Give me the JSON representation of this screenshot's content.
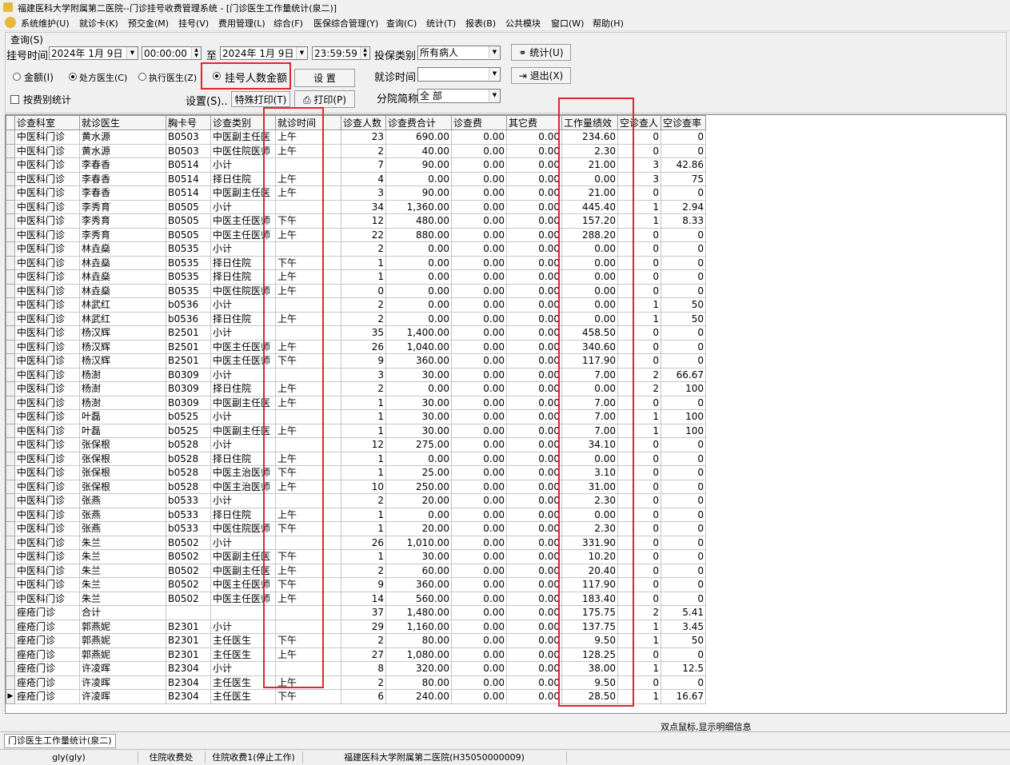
{
  "window": {
    "title": "福建医科大学附属第二医院--门诊挂号收费管理系统 - [门诊医生工作量统计(泉二)]"
  },
  "menu": [
    "系统维护(U)",
    "就诊卡(K)",
    "预交金(M)",
    "挂号(V)",
    "费用管理(L)",
    "综合(F)",
    "医保综合管理(Y)",
    "查询(C)",
    "统计(T)",
    "报表(B)",
    "公共模块",
    "窗口(W)",
    "帮助(H)"
  ],
  "query": {
    "group_label": "查询(S)",
    "reg_time_label": "挂号时间",
    "date_from": "2024年 1月 9日",
    "time_from": "00:00:00",
    "to_label": "至",
    "date_to": "2024年 1月 9日",
    "time_to": "23:59:59",
    "insurance_label": "投保类别",
    "insurance_value": "所有病人",
    "stat_button": "统计(U)",
    "exit_button": "退出(X)",
    "radio_amount": "金额(I)",
    "radio_presc_doctor": "处方医生(C)",
    "radio_exec_doctor": "执行医生(Z)",
    "radio_reg_count": "挂号人数金额",
    "setup_button": "设  置",
    "visit_time_label": "就诊时间",
    "visit_time_value": "",
    "check_fee_stat": "按费别统计",
    "settings_link": "设置(S)..",
    "special_print": "特殊打印(T)",
    "print_button": "打印(P)",
    "branch_label": "分院简称",
    "branch_value": "全 部"
  },
  "table": {
    "columns": [
      "诊查科室",
      "就诊医生",
      "胸卡号",
      "诊查类别",
      "就诊时间",
      "诊查人数",
      "诊查费合计",
      "诊查费",
      "其它费",
      "工作量绩效",
      "空诊查人",
      "空诊查率"
    ],
    "rows": [
      [
        "中医科门诊",
        "黄水源",
        "B0503",
        "中医副主任医",
        "上午",
        "23",
        "690.00",
        "0.00",
        "0.00",
        "234.60",
        "0",
        "0"
      ],
      [
        "中医科门诊",
        "黄水源",
        "B0503",
        "中医住院医师",
        "上午",
        "2",
        "40.00",
        "0.00",
        "0.00",
        "2.30",
        "0",
        "0"
      ],
      [
        "中医科门诊",
        "李春香",
        "B0514",
        "小计",
        "",
        "7",
        "90.00",
        "0.00",
        "0.00",
        "21.00",
        "3",
        "42.86"
      ],
      [
        "中医科门诊",
        "李春香",
        "B0514",
        "择日住院",
        "上午",
        "4",
        "0.00",
        "0.00",
        "0.00",
        "0.00",
        "3",
        "75"
      ],
      [
        "中医科门诊",
        "李春香",
        "B0514",
        "中医副主任医",
        "上午",
        "3",
        "90.00",
        "0.00",
        "0.00",
        "21.00",
        "0",
        "0"
      ],
      [
        "中医科门诊",
        "李秀育",
        "B0505",
        "小计",
        "",
        "34",
        "1,360.00",
        "0.00",
        "0.00",
        "445.40",
        "1",
        "2.94"
      ],
      [
        "中医科门诊",
        "李秀育",
        "B0505",
        "中医主任医师",
        "下午",
        "12",
        "480.00",
        "0.00",
        "0.00",
        "157.20",
        "1",
        "8.33"
      ],
      [
        "中医科门诊",
        "李秀育",
        "B0505",
        "中医主任医师",
        "上午",
        "22",
        "880.00",
        "0.00",
        "0.00",
        "288.20",
        "0",
        "0"
      ],
      [
        "中医科门诊",
        "林垚燊",
        "B0535",
        "小计",
        "",
        "2",
        "0.00",
        "0.00",
        "0.00",
        "0.00",
        "0",
        "0"
      ],
      [
        "中医科门诊",
        "林垚燊",
        "B0535",
        "择日住院",
        "下午",
        "1",
        "0.00",
        "0.00",
        "0.00",
        "0.00",
        "0",
        "0"
      ],
      [
        "中医科门诊",
        "林垚燊",
        "B0535",
        "择日住院",
        "上午",
        "1",
        "0.00",
        "0.00",
        "0.00",
        "0.00",
        "0",
        "0"
      ],
      [
        "中医科门诊",
        "林垚燊",
        "B0535",
        "中医住院医师",
        "上午",
        "0",
        "0.00",
        "0.00",
        "0.00",
        "0.00",
        "0",
        "0"
      ],
      [
        "中医科门诊",
        "林武红",
        "b0536",
        "小计",
        "",
        "2",
        "0.00",
        "0.00",
        "0.00",
        "0.00",
        "1",
        "50"
      ],
      [
        "中医科门诊",
        "林武红",
        "b0536",
        "择日住院",
        "上午",
        "2",
        "0.00",
        "0.00",
        "0.00",
        "0.00",
        "1",
        "50"
      ],
      [
        "中医科门诊",
        "杨汉辉",
        "B2501",
        "小计",
        "",
        "35",
        "1,400.00",
        "0.00",
        "0.00",
        "458.50",
        "0",
        "0"
      ],
      [
        "中医科门诊",
        "杨汉辉",
        "B2501",
        "中医主任医师",
        "上午",
        "26",
        "1,040.00",
        "0.00",
        "0.00",
        "340.60",
        "0",
        "0"
      ],
      [
        "中医科门诊",
        "杨汉辉",
        "B2501",
        "中医主任医师",
        "下午",
        "9",
        "360.00",
        "0.00",
        "0.00",
        "117.90",
        "0",
        "0"
      ],
      [
        "中医科门诊",
        "杨澍",
        "B0309",
        "小计",
        "",
        "3",
        "30.00",
        "0.00",
        "0.00",
        "7.00",
        "2",
        "66.67"
      ],
      [
        "中医科门诊",
        "杨澍",
        "B0309",
        "择日住院",
        "上午",
        "2",
        "0.00",
        "0.00",
        "0.00",
        "0.00",
        "2",
        "100"
      ],
      [
        "中医科门诊",
        "杨澍",
        "B0309",
        "中医副主任医",
        "上午",
        "1",
        "30.00",
        "0.00",
        "0.00",
        "7.00",
        "0",
        "0"
      ],
      [
        "中医科门诊",
        "叶磊",
        "b0525",
        "小计",
        "",
        "1",
        "30.00",
        "0.00",
        "0.00",
        "7.00",
        "1",
        "100"
      ],
      [
        "中医科门诊",
        "叶磊",
        "b0525",
        "中医副主任医",
        "上午",
        "1",
        "30.00",
        "0.00",
        "0.00",
        "7.00",
        "1",
        "100"
      ],
      [
        "中医科门诊",
        "张保根",
        "b0528",
        "小计",
        "",
        "12",
        "275.00",
        "0.00",
        "0.00",
        "34.10",
        "0",
        "0"
      ],
      [
        "中医科门诊",
        "张保根",
        "b0528",
        "择日住院",
        "上午",
        "1",
        "0.00",
        "0.00",
        "0.00",
        "0.00",
        "0",
        "0"
      ],
      [
        "中医科门诊",
        "张保根",
        "b0528",
        "中医主治医师",
        "下午",
        "1",
        "25.00",
        "0.00",
        "0.00",
        "3.10",
        "0",
        "0"
      ],
      [
        "中医科门诊",
        "张保根",
        "b0528",
        "中医主治医师",
        "上午",
        "10",
        "250.00",
        "0.00",
        "0.00",
        "31.00",
        "0",
        "0"
      ],
      [
        "中医科门诊",
        "张燕",
        "b0533",
        "小计",
        "",
        "2",
        "20.00",
        "0.00",
        "0.00",
        "2.30",
        "0",
        "0"
      ],
      [
        "中医科门诊",
        "张燕",
        "b0533",
        "择日住院",
        "上午",
        "1",
        "0.00",
        "0.00",
        "0.00",
        "0.00",
        "0",
        "0"
      ],
      [
        "中医科门诊",
        "张燕",
        "b0533",
        "中医住院医师",
        "下午",
        "1",
        "20.00",
        "0.00",
        "0.00",
        "2.30",
        "0",
        "0"
      ],
      [
        "中医科门诊",
        "朱兰",
        "B0502",
        "小计",
        "",
        "26",
        "1,010.00",
        "0.00",
        "0.00",
        "331.90",
        "0",
        "0"
      ],
      [
        "中医科门诊",
        "朱兰",
        "B0502",
        "中医副主任医",
        "下午",
        "1",
        "30.00",
        "0.00",
        "0.00",
        "10.20",
        "0",
        "0"
      ],
      [
        "中医科门诊",
        "朱兰",
        "B0502",
        "中医副主任医",
        "上午",
        "2",
        "60.00",
        "0.00",
        "0.00",
        "20.40",
        "0",
        "0"
      ],
      [
        "中医科门诊",
        "朱兰",
        "B0502",
        "中医主任医师",
        "下午",
        "9",
        "360.00",
        "0.00",
        "0.00",
        "117.90",
        "0",
        "0"
      ],
      [
        "中医科门诊",
        "朱兰",
        "B0502",
        "中医主任医师",
        "上午",
        "14",
        "560.00",
        "0.00",
        "0.00",
        "183.40",
        "0",
        "0"
      ],
      [
        "痤疮门诊",
        "合计",
        "",
        "",
        "",
        "37",
        "1,480.00",
        "0.00",
        "0.00",
        "175.75",
        "2",
        "5.41"
      ],
      [
        "痤疮门诊",
        "郭燕妮",
        "B2301",
        "小计",
        "",
        "29",
        "1,160.00",
        "0.00",
        "0.00",
        "137.75",
        "1",
        "3.45"
      ],
      [
        "痤疮门诊",
        "郭燕妮",
        "B2301",
        "主任医生",
        "下午",
        "2",
        "80.00",
        "0.00",
        "0.00",
        "9.50",
        "1",
        "50"
      ],
      [
        "痤疮门诊",
        "郭燕妮",
        "B2301",
        "主任医生",
        "上午",
        "27",
        "1,080.00",
        "0.00",
        "0.00",
        "128.25",
        "0",
        "0"
      ],
      [
        "痤疮门诊",
        "许凌晖",
        "B2304",
        "小计",
        "",
        "8",
        "320.00",
        "0.00",
        "0.00",
        "38.00",
        "1",
        "12.5"
      ],
      [
        "痤疮门诊",
        "许凌晖",
        "B2304",
        "主任医生",
        "上午",
        "2",
        "80.00",
        "0.00",
        "0.00",
        "9.50",
        "0",
        "0"
      ],
      [
        "痤疮门诊",
        "许凌晖",
        "B2304",
        "主任医生",
        "下午",
        "6",
        "240.00",
        "0.00",
        "0.00",
        "28.50",
        "1",
        "16.67"
      ]
    ]
  },
  "hint": "双点鼠标,显示明细信息",
  "tab": "门诊医生工作量统计(泉二)",
  "status": {
    "user": "gly(gly)",
    "dept": "住院收费处",
    "station": "住院收费1(停止工作)",
    "hospital": "福建医科大学附属第二医院(H35050000009)"
  },
  "colors": {
    "highlight_border": "#e0262b",
    "app_icon": "#e8b63a"
  },
  "icons": {
    "app": "app-logo-icon",
    "stat": "binoculars-icon",
    "exit": "exit-door-icon",
    "print": "printer-icon"
  }
}
